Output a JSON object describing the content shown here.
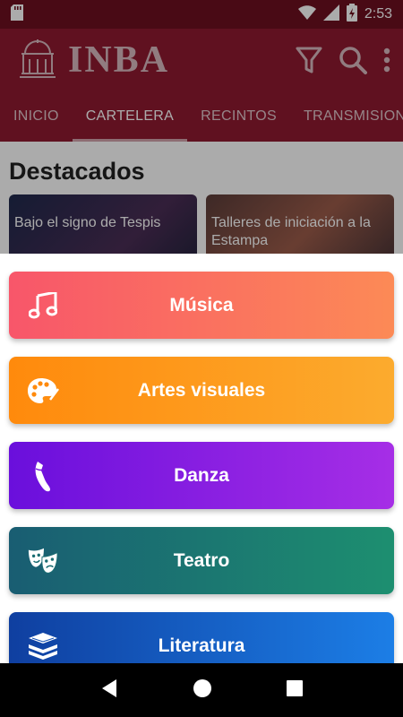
{
  "status_bar": {
    "time": "2:53"
  },
  "app_bar": {
    "logo_text": "INBA",
    "filter_icon": "filter-icon",
    "search_icon": "search-icon",
    "menu_icon": "more-vert-icon"
  },
  "tabs": [
    {
      "label": "INICIO"
    },
    {
      "label": "CARTELERA"
    },
    {
      "label": "RECINTOS"
    },
    {
      "label": "TRANSMISIONES"
    }
  ],
  "content": {
    "section_title": "Destacados",
    "cards": [
      {
        "caption": "Bajo el signo de Tespis"
      },
      {
        "caption": "Talleres de iniciación a la Estampa"
      }
    ]
  },
  "categories": [
    {
      "label": "Música",
      "icon": "music-note-icon",
      "color_start": "#f8566a",
      "color_end": "#fc8a56"
    },
    {
      "label": "Artes visuales",
      "icon": "palette-icon",
      "color_start": "#ff8a0c",
      "color_end": "#fcab2e"
    },
    {
      "label": "Danza",
      "icon": "dance-shoe-icon",
      "color_start": "#6a0fdc",
      "color_end": "#a62ee6"
    },
    {
      "label": "Teatro",
      "icon": "theater-masks-icon",
      "color_start": "#195d72",
      "color_end": "#1d8f70"
    },
    {
      "label": "Literatura",
      "icon": "books-icon",
      "color_start": "#0f3fa0",
      "color_end": "#1c7ee6"
    }
  ],
  "colors": {
    "primary": "#8f1a31",
    "status": "#6e0f20"
  }
}
